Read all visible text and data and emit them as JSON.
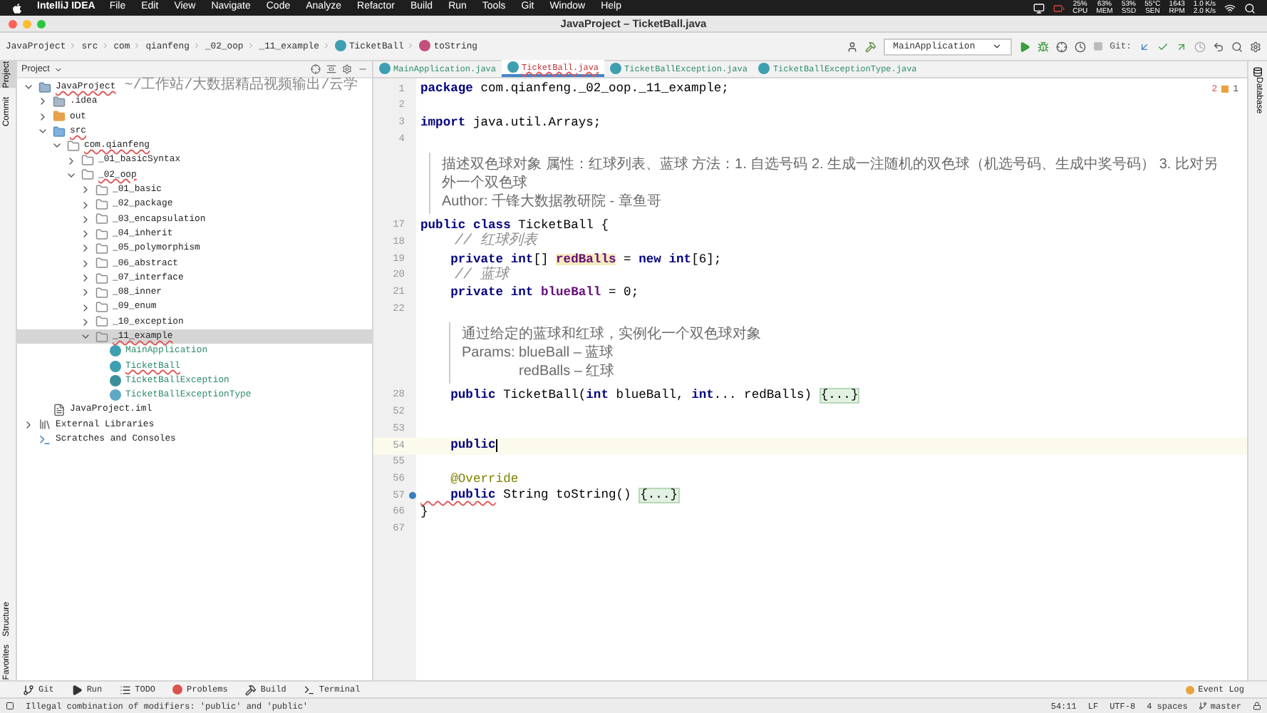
{
  "menubar": {
    "app": "IntelliJ IDEA",
    "menus": [
      "File",
      "Edit",
      "View",
      "Navigate",
      "Code",
      "Analyze",
      "Refactor",
      "Build",
      "Run",
      "Tools",
      "Git",
      "Window",
      "Help"
    ],
    "stats": [
      {
        "value": "25%",
        "label": "CPU"
      },
      {
        "value": "63%",
        "label": "MEM"
      },
      {
        "value": "53%",
        "label": "SSD"
      },
      {
        "value": "55°C",
        "label": "SEN"
      },
      {
        "value": "1643",
        "label": "RPM"
      }
    ],
    "network": [
      "1.0 K/s",
      "2.0 K/s"
    ]
  },
  "window": {
    "title": "JavaProject – TicketBall.java"
  },
  "breadcrumb": [
    {
      "label": "JavaProject",
      "kind": "folder"
    },
    {
      "label": "src",
      "kind": "folder"
    },
    {
      "label": "com",
      "kind": "folder"
    },
    {
      "label": "qianfeng",
      "kind": "folder"
    },
    {
      "label": "_02_oop",
      "kind": "folder"
    },
    {
      "label": "_11_example",
      "kind": "folder"
    },
    {
      "label": "TicketBall",
      "kind": "class"
    },
    {
      "label": "toString",
      "kind": "method"
    }
  ],
  "toolbar": {
    "run_config": "MainApplication",
    "git_label": "Git:"
  },
  "left_strip": [
    {
      "label": "Project",
      "selected": true
    },
    {
      "label": "Commit",
      "selected": false
    }
  ],
  "left_strip_bottom": [
    {
      "label": "Structure",
      "selected": false
    },
    {
      "label": "Favorites",
      "selected": false
    }
  ],
  "right_strip": [
    "Database"
  ],
  "project_panel": {
    "title": "Project",
    "tree": [
      {
        "label": "JavaProject",
        "hint": "~/工作站/大数据精品视频输出/云学",
        "kind": "module",
        "expanded": true,
        "selected": false,
        "error": true,
        "children": [
          {
            "label": ".idea",
            "kind": "folder",
            "expanded": false,
            "selected": false,
            "error": false
          },
          {
            "label": "out",
            "kind": "output",
            "expanded": false,
            "selected": false,
            "error": false
          },
          {
            "label": "src",
            "kind": "source",
            "expanded": true,
            "selected": false,
            "error": true,
            "children": [
              {
                "label": "com.qianfeng",
                "kind": "package",
                "expanded": true,
                "selected": false,
                "error": true,
                "children": [
                  {
                    "label": "_01_basicSyntax",
                    "kind": "package",
                    "expanded": false,
                    "selected": false,
                    "error": false
                  },
                  {
                    "label": "_02_oop",
                    "kind": "package",
                    "expanded": true,
                    "selected": false,
                    "error": true,
                    "children": [
                      {
                        "label": "_01_basic",
                        "kind": "package",
                        "expanded": false,
                        "selected": false,
                        "error": false
                      },
                      {
                        "label": "_02_package",
                        "kind": "package",
                        "expanded": false,
                        "selected": false,
                        "error": false
                      },
                      {
                        "label": "_03_encapsulation",
                        "kind": "package",
                        "expanded": false,
                        "selected": false,
                        "error": false
                      },
                      {
                        "label": "_04_inherit",
                        "kind": "package",
                        "expanded": false,
                        "selected": false,
                        "error": false
                      },
                      {
                        "label": "_05_polymorphism",
                        "kind": "package",
                        "expanded": false,
                        "selected": false,
                        "error": false
                      },
                      {
                        "label": "_06_abstract",
                        "kind": "package",
                        "expanded": false,
                        "selected": false,
                        "error": false
                      },
                      {
                        "label": "_07_interface",
                        "kind": "package",
                        "expanded": false,
                        "selected": false,
                        "error": false
                      },
                      {
                        "label": "_08_inner",
                        "kind": "package",
                        "expanded": false,
                        "selected": false,
                        "error": false
                      },
                      {
                        "label": "_09_enum",
                        "kind": "package",
                        "expanded": false,
                        "selected": false,
                        "error": false
                      },
                      {
                        "label": "_10_exception",
                        "kind": "package",
                        "expanded": false,
                        "selected": false,
                        "error": false
                      },
                      {
                        "label": "_11_example",
                        "kind": "package",
                        "expanded": true,
                        "selected": true,
                        "error": true,
                        "children": [
                          {
                            "label": "MainApplication",
                            "kind": "class",
                            "selected": false,
                            "error": false
                          },
                          {
                            "label": "TicketBall",
                            "kind": "class",
                            "selected": false,
                            "error": true
                          },
                          {
                            "label": "TicketBallException",
                            "kind": "exception",
                            "selected": false,
                            "error": false
                          },
                          {
                            "label": "TicketBallExceptionType",
                            "kind": "enum",
                            "selected": false,
                            "error": false
                          }
                        ]
                      }
                    ]
                  }
                ]
              }
            ]
          },
          {
            "label": "JavaProject.iml",
            "kind": "file",
            "selected": false,
            "error": false
          }
        ]
      },
      {
        "label": "External Libraries",
        "kind": "library",
        "expanded": false,
        "selected": false,
        "error": false
      },
      {
        "label": "Scratches and Consoles",
        "kind": "scratch",
        "selected": false,
        "error": false
      }
    ]
  },
  "tabs": [
    {
      "label": "MainApplication.java",
      "selected": false,
      "error": false
    },
    {
      "label": "TicketBall.java",
      "selected": true,
      "error": true
    },
    {
      "label": "TicketBallException.java",
      "selected": false,
      "error": false
    },
    {
      "label": "TicketBallExceptionType.java",
      "selected": false,
      "error": false
    }
  ],
  "editor": {
    "errors": "2",
    "warnings": "1",
    "lines": [
      {
        "kind": "code",
        "number": "1",
        "current": false,
        "tokens": [
          {
            "kind": "keyword",
            "text": "package"
          },
          {
            "kind": "plain",
            "text": " com.qianfeng._02_oop._11_example;"
          }
        ]
      },
      {
        "kind": "code",
        "number": "2",
        "current": false
      },
      {
        "kind": "code",
        "number": "3",
        "current": false,
        "tokens": [
          {
            "kind": "keyword",
            "text": "import"
          },
          {
            "kind": "plain",
            "text": " java.util.Arrays;"
          }
        ]
      },
      {
        "kind": "code",
        "number": "4",
        "current": false
      },
      {
        "kind": "doc",
        "indent": false,
        "paragraphs": [
          "描述双色球对象 属性：红球列表、蓝球 方法：1. 自选号码 2. 生成一注随机的双色球（机选号码、生成中奖号码） 3. 比对另外一个双色球",
          "Author: 千锋大数据教研院 - 章鱼哥"
        ]
      },
      {
        "kind": "code",
        "number": "17",
        "current": false,
        "tokens": [
          {
            "kind": "keyword",
            "text": "public class"
          },
          {
            "kind": "plain",
            "text": " TicketBall {"
          }
        ]
      },
      {
        "kind": "code",
        "number": "18",
        "current": false,
        "tokens": [
          {
            "kind": "comment",
            "text": "    // 红球列表"
          }
        ]
      },
      {
        "kind": "code",
        "number": "19",
        "current": false,
        "tokens": [
          {
            "kind": "keyword",
            "text": "    private int"
          },
          {
            "kind": "plain",
            "text": "[] "
          },
          {
            "kind": "field-highlight",
            "text": "redBalls"
          },
          {
            "kind": "plain",
            "text": " = "
          },
          {
            "kind": "keyword",
            "text": "new int"
          },
          {
            "kind": "plain",
            "text": "[6];"
          }
        ]
      },
      {
        "kind": "code",
        "number": "20",
        "current": false,
        "tokens": [
          {
            "kind": "comment",
            "text": "    // 蓝球"
          }
        ]
      },
      {
        "kind": "code",
        "number": "21",
        "current": false,
        "tokens": [
          {
            "kind": "keyword",
            "text": "    private int"
          },
          {
            "kind": "field",
            "text": " blueBall"
          },
          {
            "kind": "plain",
            "text": " = 0;"
          }
        ]
      },
      {
        "kind": "code",
        "number": "22",
        "current": false
      },
      {
        "kind": "doc",
        "indent": true,
        "paragraphs": [
          "通过给定的蓝球和红球，实例化一个双色球对象",
          "Params: blueBall – 蓝球",
          "redBalls – 红球"
        ]
      },
      {
        "kind": "code",
        "number": "28",
        "current": false,
        "tokens": [
          {
            "kind": "keyword",
            "text": "    public"
          },
          {
            "kind": "plain",
            "text": " TicketBall("
          },
          {
            "kind": "keyword",
            "text": "int"
          },
          {
            "kind": "plain",
            "text": " blueBall, "
          },
          {
            "kind": "keyword",
            "text": "int"
          },
          {
            "kind": "plain",
            "text": "... redBalls) "
          },
          {
            "kind": "fold",
            "text": "{...}"
          }
        ]
      },
      {
        "kind": "code",
        "number": "52",
        "current": false
      },
      {
        "kind": "code",
        "number": "53",
        "current": false
      },
      {
        "kind": "code",
        "number": "54",
        "current": true,
        "tokens": [
          {
            "kind": "keyword",
            "text": "    public"
          }
        ]
      },
      {
        "kind": "code",
        "number": "55",
        "current": false
      },
      {
        "kind": "code",
        "number": "56",
        "current": false,
        "tokens": [
          {
            "kind": "annotation",
            "text": "    @Override"
          }
        ]
      },
      {
        "kind": "code",
        "number": "57",
        "current": false,
        "override": true,
        "tokens": [
          {
            "kind": "error-keyword",
            "text": "    public"
          },
          {
            "kind": "plain",
            "text": " String toString() "
          },
          {
            "kind": "fold",
            "text": "{...}"
          }
        ]
      },
      {
        "kind": "code",
        "number": "66",
        "current": false,
        "tokens": [
          {
            "kind": "plain",
            "text": "}"
          }
        ]
      },
      {
        "kind": "code",
        "number": "67",
        "current": false
      }
    ]
  },
  "tool_windows": [
    {
      "label": "Git",
      "kind": "git"
    },
    {
      "label": "Run",
      "kind": "run"
    },
    {
      "label": "TODO",
      "kind": "list"
    },
    {
      "label": "Problems",
      "kind": "problems"
    },
    {
      "label": "Build",
      "kind": "build"
    },
    {
      "label": "Terminal",
      "kind": "terminal"
    }
  ],
  "event_log": "Event Log",
  "status_bar": {
    "message": "Illegal combination of modifiers: 'public' and 'public'",
    "items": [
      "54:11",
      "LF",
      "UTF-8",
      "4 spaces"
    ],
    "branch": "master"
  }
}
